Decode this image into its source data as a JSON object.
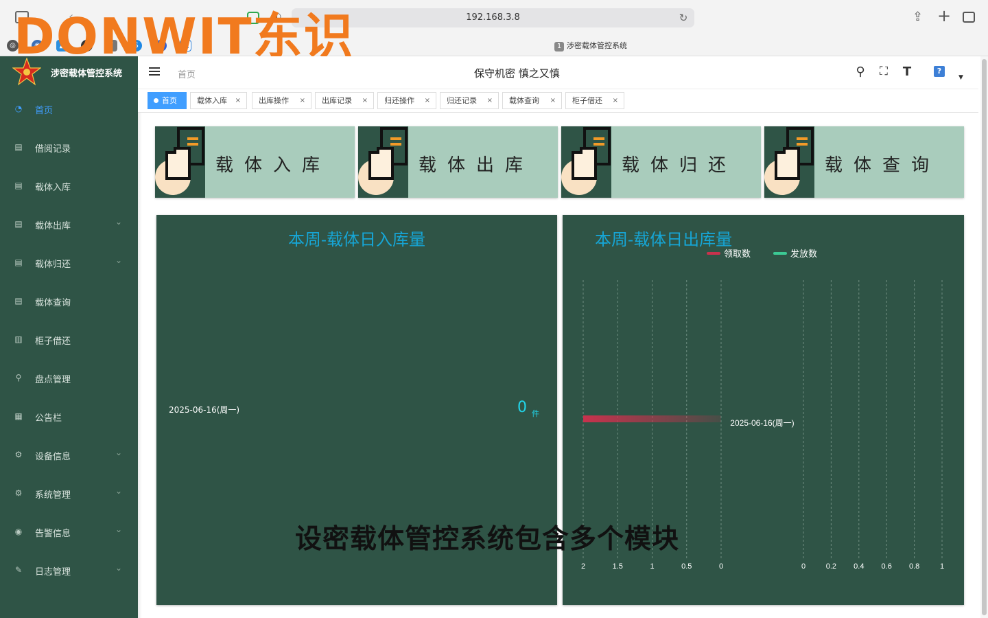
{
  "browser": {
    "address": "192.168.3.8",
    "tab_badge": "1",
    "tab_title": "涉密载体管控系统"
  },
  "watermark": "DONWIT东识",
  "sidebar": {
    "system_name": "涉密载体管控系统",
    "items": [
      {
        "label": "首页",
        "icon": "dashboard-icon",
        "glyph": "◔",
        "expandable": false,
        "active": true
      },
      {
        "label": "借阅记录",
        "icon": "record-icon",
        "glyph": "▤",
        "expandable": false,
        "active": false
      },
      {
        "label": "载体入库",
        "icon": "record-icon",
        "glyph": "▤",
        "expandable": false,
        "active": false
      },
      {
        "label": "载体出库",
        "icon": "record-icon",
        "glyph": "▤",
        "expandable": true,
        "active": false
      },
      {
        "label": "载体归还",
        "icon": "record-icon",
        "glyph": "▤",
        "expandable": true,
        "active": false
      },
      {
        "label": "载体查询",
        "icon": "record-icon",
        "glyph": "▤",
        "expandable": false,
        "active": false
      },
      {
        "label": "柜子借还",
        "icon": "cabinet-icon",
        "glyph": "▥",
        "expandable": false,
        "active": false
      },
      {
        "label": "盘点管理",
        "icon": "search-icon",
        "glyph": "⚲",
        "expandable": false,
        "active": false
      },
      {
        "label": "公告栏",
        "icon": "notice-icon",
        "glyph": "▦",
        "expandable": false,
        "active": false
      },
      {
        "label": "设备信息",
        "icon": "gear-icon",
        "glyph": "⚙",
        "expandable": true,
        "active": false
      },
      {
        "label": "系统管理",
        "icon": "gear-icon",
        "glyph": "⚙",
        "expandable": true,
        "active": false
      },
      {
        "label": "告警信息",
        "icon": "signal-icon",
        "glyph": "◉",
        "expandable": true,
        "active": false
      },
      {
        "label": "日志管理",
        "icon": "log-icon",
        "glyph": "✎",
        "expandable": true,
        "active": false
      }
    ]
  },
  "header": {
    "breadcrumb": "首页",
    "slogan": "保守机密 慎之又慎",
    "help": "?"
  },
  "tags": [
    {
      "label": "首页",
      "active": true
    },
    {
      "label": "载体入库",
      "active": false
    },
    {
      "label": "出库操作",
      "active": false
    },
    {
      "label": "出库记录",
      "active": false
    },
    {
      "label": "归还操作",
      "active": false
    },
    {
      "label": "归还记录",
      "active": false
    },
    {
      "label": "载体查询",
      "active": false
    },
    {
      "label": "柜子借还",
      "active": false
    }
  ],
  "cards": [
    {
      "label": "载体入库"
    },
    {
      "label": "载体出库"
    },
    {
      "label": "载体归还"
    },
    {
      "label": "载体查询"
    }
  ],
  "colors": {
    "sidebar": "#2f5446",
    "card": "#a9ccbc",
    "accent": "#409eff",
    "chart_title": "#16a6d6",
    "series_receive": "#c8324d",
    "series_issue": "#3cc994"
  },
  "chart_data": [
    {
      "type": "table",
      "title": "本周-载体日入库量",
      "rows": [
        {
          "date": "2025-06-16(周一)",
          "value": 0,
          "unit": "件"
        }
      ]
    },
    {
      "type": "bar",
      "orientation": "horizontal-mirrored",
      "title": "本周-载体日出库量",
      "categories": [
        "2025-06-16(周一)"
      ],
      "series": [
        {
          "name": "领取数",
          "values": [
            2
          ],
          "xlim": [
            2,
            0
          ],
          "ticks": [
            "2",
            "1.5",
            "1",
            "0.5",
            "0"
          ]
        },
        {
          "name": "发放数",
          "values": [
            0
          ],
          "xlim": [
            0,
            1
          ],
          "ticks": [
            "0",
            "0.2",
            "0.4",
            "0.6",
            "0.8",
            "1"
          ]
        }
      ],
      "legend": "top"
    }
  ],
  "caption": "设密载体管控系统包含多个模块"
}
